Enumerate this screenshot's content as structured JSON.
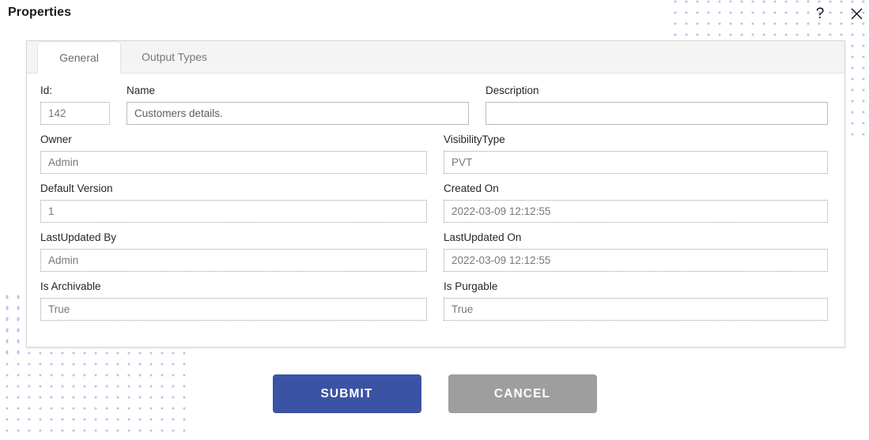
{
  "header": {
    "title": "Properties",
    "help_icon": "question-mark-icon",
    "help_glyph": "?",
    "close_icon": "close-icon"
  },
  "tabs": [
    {
      "label": "General",
      "active": true
    },
    {
      "label": "Output Types",
      "active": false
    }
  ],
  "form": {
    "fields": [
      {
        "name": "id",
        "label": "Id:",
        "value": "142",
        "style": "dotted",
        "readonly": true
      },
      {
        "name": "name",
        "label": "Name",
        "value": "Customers details.",
        "style": "solid",
        "readonly": false
      },
      {
        "name": "description",
        "label": "Description",
        "value": "",
        "style": "solid",
        "readonly": false,
        "placeholder": ""
      },
      {
        "name": "owner",
        "label": "Owner",
        "value": "Admin",
        "style": "dotted",
        "readonly": true
      },
      {
        "name": "visibility_type",
        "label": "VisibilityType",
        "value": "PVT",
        "style": "dotted",
        "readonly": true
      },
      {
        "name": "default_version",
        "label": "Default Version",
        "value": "1",
        "style": "dotted",
        "readonly": true
      },
      {
        "name": "created_on",
        "label": "Created On",
        "value": "2022-03-09 12:12:55",
        "style": "dotted",
        "readonly": true
      },
      {
        "name": "lastupdated_by",
        "label": "LastUpdated By",
        "value": "Admin",
        "style": "dotted",
        "readonly": true
      },
      {
        "name": "lastupdated_on",
        "label": "LastUpdated On",
        "value": "2022-03-09 12:12:55",
        "style": "dotted",
        "readonly": true
      },
      {
        "name": "is_archivable",
        "label": "Is Archivable",
        "value": "True",
        "style": "dotted",
        "readonly": true
      },
      {
        "name": "is_purgable",
        "label": "Is Purgable",
        "value": "True",
        "style": "dotted",
        "readonly": true
      }
    ]
  },
  "footer": {
    "submit_label": "SUBMIT",
    "cancel_label": "CANCEL"
  },
  "colors": {
    "submit_blue": "#3a53a4",
    "cancel_gray": "#9e9e9e",
    "dot_pattern": "#b9c2ea",
    "tab_strip": "#f4f4f4",
    "card_border": "#d6d6d6"
  }
}
